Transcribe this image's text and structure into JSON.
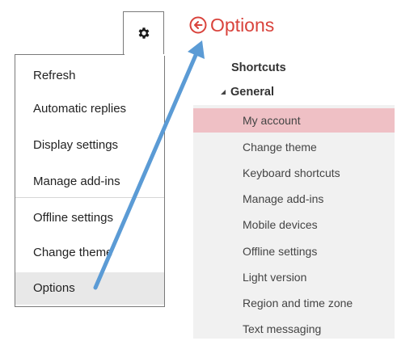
{
  "settings_menu": {
    "items": [
      {
        "label": "Refresh"
      },
      {
        "label": "Automatic replies"
      },
      {
        "label": "Display settings"
      },
      {
        "label": "Manage add-ins"
      },
      {
        "label": "Offline settings"
      },
      {
        "label": "Change theme"
      },
      {
        "label": "Options"
      }
    ],
    "selected": "Options"
  },
  "options_panel": {
    "title": "Options",
    "back_icon": "circle-arrow-left-icon",
    "shortcuts_label": "Shortcuts",
    "general_label": "General",
    "general_items": [
      {
        "label": "My account"
      },
      {
        "label": "Change theme"
      },
      {
        "label": "Keyboard shortcuts"
      },
      {
        "label": "Manage add-ins"
      },
      {
        "label": "Mobile devices"
      },
      {
        "label": "Offline settings"
      },
      {
        "label": "Light version"
      },
      {
        "label": "Region and time zone"
      },
      {
        "label": "Text messaging"
      }
    ],
    "selected": "My account"
  },
  "colors": {
    "accent": "#d9433c",
    "selected_nav": "#efc0c5",
    "panel_bg": "#f1f1f1",
    "arrow": "#5b9bd5"
  },
  "icons": {
    "gear": "gear-icon",
    "expand": "triangle-expanded-icon"
  }
}
